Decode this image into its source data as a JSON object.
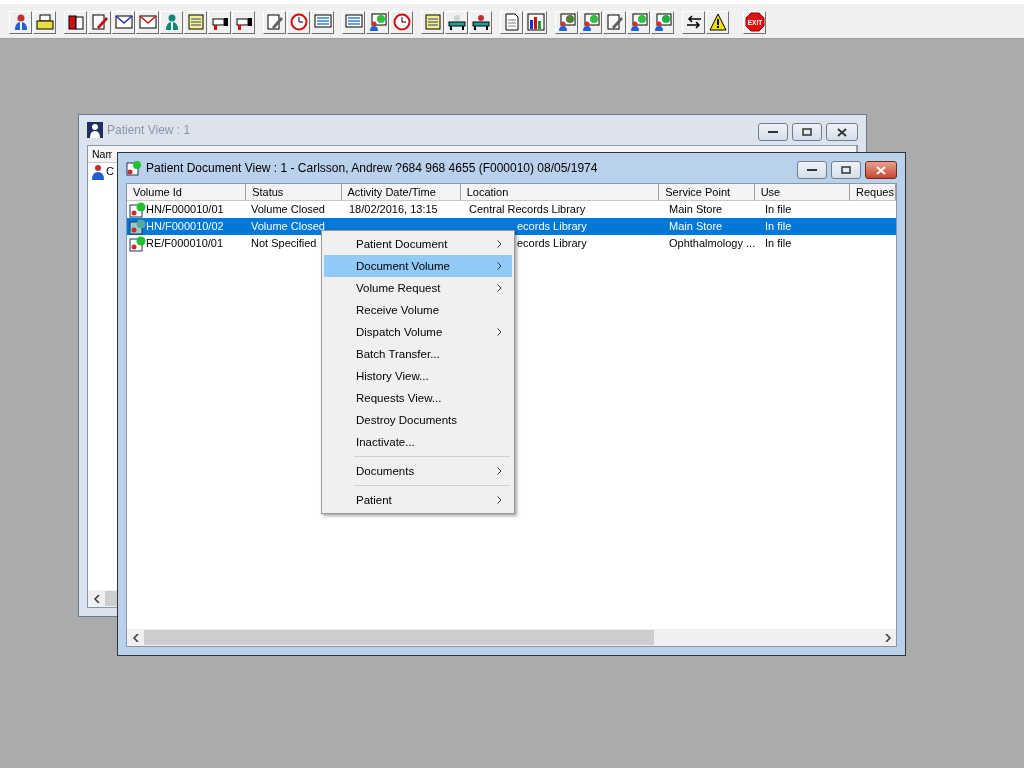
{
  "toolbar": {
    "exit_label": "EXIT"
  },
  "back_window": {
    "title": "Patient View : 1",
    "active": false,
    "columns": [
      "Nam"
    ],
    "rows": [
      {
        "name": "C"
      }
    ]
  },
  "front_window": {
    "title": "Patient Document View : 1 - Carlsson, Andrew ?684 968 4655 (F000010) 08/05/1974",
    "active": true,
    "columns": [
      "Volume Id",
      "Status",
      "Activity Date/Time",
      "Location",
      "Service Point",
      "Use",
      "Reques"
    ],
    "rows": [
      {
        "selected": false,
        "volume_id": "HN/F000010/01",
        "status": "Volume Closed",
        "activity": "18/02/2016, 13:15",
        "location": "Central Records Library",
        "location_covered": false,
        "service_point": "Main Store",
        "use": "In file"
      },
      {
        "selected": true,
        "volume_id": "HN/F000010/02",
        "status": "Volume Closed",
        "location": "ecords Library",
        "location_covered": true,
        "service_point": "Main Store",
        "use": "In file"
      },
      {
        "selected": false,
        "volume_id": "RE/F000010/01",
        "status": "Not Specified",
        "location": "ecords Library",
        "location_covered": true,
        "service_point": "Ophthalmology ...",
        "use": "In file"
      }
    ]
  },
  "context_menu": {
    "items": [
      {
        "kind": "item",
        "label": "Patient Document",
        "submenu": true,
        "selected": false
      },
      {
        "kind": "item",
        "label": "Document Volume",
        "submenu": true,
        "selected": true
      },
      {
        "kind": "item",
        "label": "Volume Request",
        "submenu": true,
        "selected": false
      },
      {
        "kind": "item",
        "label": "Receive Volume",
        "submenu": false,
        "selected": false
      },
      {
        "kind": "item",
        "label": "Dispatch Volume",
        "submenu": true,
        "selected": false
      },
      {
        "kind": "item",
        "label": "Batch Transfer...",
        "submenu": false,
        "selected": false
      },
      {
        "kind": "item",
        "label": "History View...",
        "submenu": false,
        "selected": false
      },
      {
        "kind": "item",
        "label": "Requests View...",
        "submenu": false,
        "selected": false
      },
      {
        "kind": "item",
        "label": "Destroy Documents",
        "submenu": false,
        "selected": false
      },
      {
        "kind": "item",
        "label": "Inactivate...",
        "submenu": false,
        "selected": false
      },
      {
        "kind": "separator"
      },
      {
        "kind": "item",
        "label": "Documents",
        "submenu": true,
        "selected": false
      },
      {
        "kind": "separator"
      },
      {
        "kind": "item",
        "label": "Patient",
        "submenu": true,
        "selected": false
      }
    ]
  }
}
